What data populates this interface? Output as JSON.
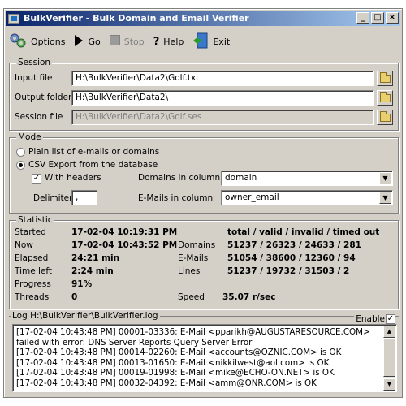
{
  "window": {
    "title": "BulkVerifier - Bulk Domain and Email Verifier",
    "caption_buttons": [
      "_",
      "□",
      "×"
    ]
  },
  "toolbar": {
    "options": "Options",
    "go": "Go",
    "stop": "Stop",
    "help": "Help",
    "exit": "Exit"
  },
  "session": {
    "legend": "Session",
    "input_label": "Input file",
    "input_value": "H:\\BulkVerifier\\Data2\\Golf.txt",
    "output_label": "Output folder",
    "output_value": "H:\\BulkVerifier\\Data2\\",
    "session_label": "Session file",
    "session_value": "H:\\BulkVerifier\\Data2\\Golf.ses"
  },
  "mode": {
    "legend": "Mode",
    "plain_label": "Plain list of e-mails or domains",
    "csv_label": "CSV Export from the database",
    "headers_label": "With headers",
    "headers_checked": "✓",
    "delimiter_label": "Delimiter",
    "delimiter_value": ",",
    "domains_label": "Domains in column",
    "domains_value": "domain",
    "emails_label": "E-Mails in column",
    "emails_value": "owner_email"
  },
  "statistic": {
    "legend": "Statistic",
    "started_label": "Started",
    "started_value": "17-02-04 10:19:31 PM",
    "now_label": "Now",
    "now_value": "17-02-04 10:43:52 PM",
    "elapsed_label": "Elapsed",
    "elapsed_value": "24:21 min",
    "timeleft_label": "Time left",
    "timeleft_value": "2:24 min",
    "progress_label": "Progress",
    "progress_value": "91%",
    "threads_label": "Threads",
    "threads_value": "0",
    "header": "total / valid / invalid / timed out",
    "domains_label": "Domains",
    "domains_value": "51237 / 26323 / 24633 / 281",
    "emails_label": "E-Mails",
    "emails_value": "51054 / 38600 / 12360 / 94",
    "lines_label": "Lines",
    "lines_value": "51237 / 19732 / 31503 / 2",
    "speed_label": "Speed",
    "speed_value": "35.07 r/sec"
  },
  "log": {
    "legend": "Log H:\\BulkVerifier\\BulkVerifier.log",
    "enable_label": "Enable",
    "enable_checked": "✓",
    "lines": [
      "[17-02-04 10:43:48 PM] 00001-03336: E-Mail <pparikh@AUGUSTARESOURCE.COM> failed with error: DNS Server Reports Query Server Error",
      "[17-02-04 10:43:48 PM] 00014-02260: E-Mail <accounts@OZNIC.COM> is OK",
      "[17-02-04 10:43:48 PM] 00013-01650: E-Mail <nikkilwest@aol.com> is OK",
      "[17-02-04 10:43:48 PM] 00019-01998: E-Mail <mike@ECHO-ON.NET> is OK",
      "[17-02-04 10:43:48 PM] 00032-04392: E-Mail <amm@ONR.COM> is OK"
    ]
  },
  "colors": {
    "titlebar_start": "#0a246a",
    "titlebar_end": "#a6caf0",
    "face": "#d4d0c8"
  }
}
